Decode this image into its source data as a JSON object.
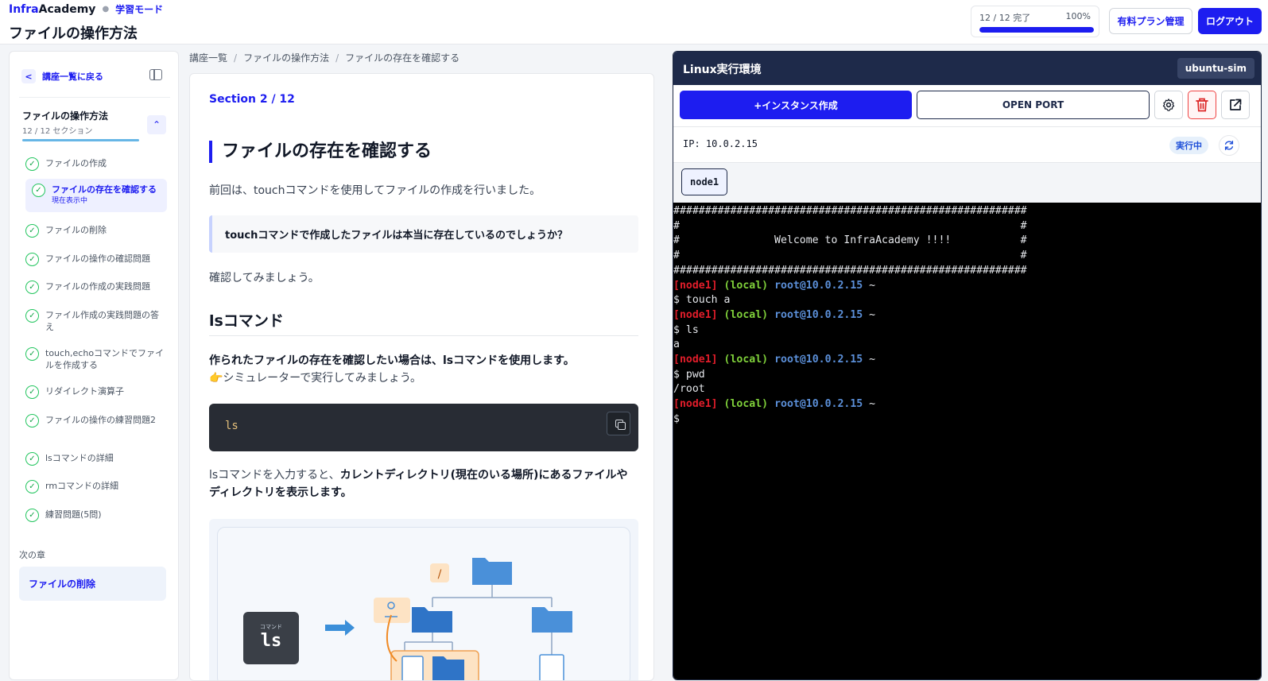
{
  "header": {
    "brand_infra": "Infra",
    "brand_academy": "Academy",
    "mode": "学習モード",
    "page_title": "ファイルの操作方法",
    "progress_text": "12 / 12 完了",
    "progress_pct_text": "100%",
    "progress_value": 100,
    "plan_button": "有料プラン管理",
    "logout_button": "ログアウト"
  },
  "sidebar": {
    "back_label": "講座一覧に戻る",
    "course_title": "ファイルの操作方法",
    "course_sub": "12 / 12 セクション",
    "lessons": [
      {
        "label": "ファイルの作成"
      },
      {
        "label": "ファイルの存在を確認する",
        "sub": "現在表示中"
      },
      {
        "label": "ファイルの削除"
      },
      {
        "label": "ファイルの操作の確認問題"
      },
      {
        "label": "ファイルの作成の実践問題"
      },
      {
        "label": "ファイル作成の実践問題の答え"
      },
      {
        "label": "touch,echoコマンドでファイルを作成する"
      },
      {
        "label": "リダイレクト演算子"
      },
      {
        "label": "ファイルの操作の練習問題2"
      },
      {
        "label": "lsコマンドの詳細"
      },
      {
        "label": "rmコマンドの詳細"
      },
      {
        "label": "練習問題(5問)"
      }
    ],
    "next_label": "次の章",
    "next_title": "ファイルの削除"
  },
  "breadcrumb": [
    "講座一覧",
    "ファイルの操作方法",
    "ファイルの存在を確認する"
  ],
  "content": {
    "section_label": "Section 2 / 12",
    "h1": "ファイルの存在を確認する",
    "p1": "前回は、touchコマンドを使用してファイルの作成を行いました。",
    "callout": "touchコマンドで作成したファイルは本当に存在しているのでしょうか？",
    "p2": "確認してみましょう。",
    "h2": "lsコマンド",
    "p3_bold": "作られたファイルの存在を確認したい場合は、lsコマンドを使用します。",
    "p3_line2": "👉シミュレーターで実行してみましょう。",
    "code": "ls",
    "p4_a": "lsコマンドを入力すると、",
    "p4_b": "カレントディレクトリ(現在のいる場所)にあるファイルやディレクトリを表示します。",
    "diagram": {
      "cmd_small": "コマンド",
      "cmd_big": "ls",
      "root_label": "/"
    }
  },
  "terminal_panel": {
    "title": "Linux実行環境",
    "badge": "ubuntu-sim",
    "create_button": "+インスタンス作成",
    "port_button": "OPEN PORT",
    "ip": "IP: 10.0.2.15",
    "status": "実行中",
    "node_tab": "node1",
    "banner": [
      "########################################################",
      "#                                                      #",
      "#               Welcome to InfraAcademy !!!!           #",
      "#                                                      #",
      "########################################################"
    ],
    "prompt": {
      "node": "[node1]",
      "local": "(local)",
      "host": "root@10.0.2.15",
      "tail": "~"
    },
    "commands": [
      {
        "cmd": "$ touch a",
        "out": ""
      },
      {
        "cmd": "$ ls",
        "out": "a"
      },
      {
        "cmd": "$ pwd",
        "out": "/root"
      }
    ],
    "last_line": "$"
  },
  "colors": {
    "accent": "#1d1df0",
    "terminal_bg": "#000000",
    "panel_header": "#1e2a4a",
    "success": "#22c55e"
  }
}
